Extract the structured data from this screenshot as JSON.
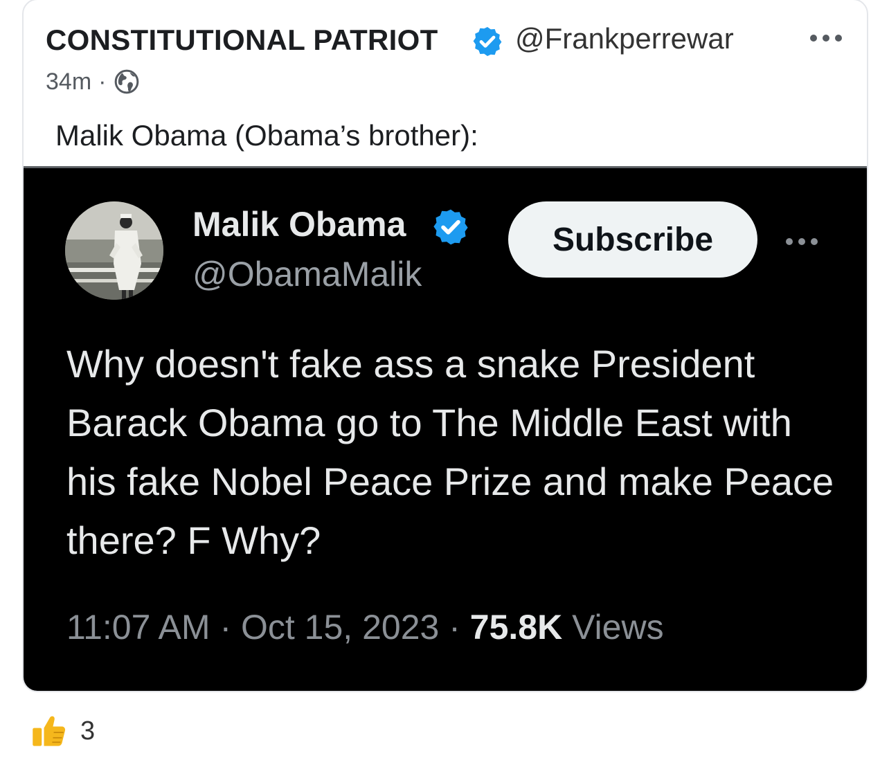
{
  "post": {
    "author_name": "CONSTITUTIONAL PATRIOT",
    "author_handle": "@Frankperrewar",
    "time_ago": "34m",
    "separator": "·",
    "caption": "Malik Obama (Obama’s brother):",
    "visibility_icon": "globe-icon",
    "more_icon": "more-options-icon"
  },
  "embedded_tweet": {
    "name": "Malik Obama",
    "handle": "@ObamaMalik",
    "subscribe_label": "Subscribe",
    "text": "Why doesn't fake ass a snake President Barack Obama go to The Middle East with his fake Nobel Peace Prize and make Peace there? F Why?",
    "time": "11:07 AM",
    "date": "Oct 15, 2023",
    "separator": "·",
    "views_count": "75.8K",
    "views_label": "Views"
  },
  "reactions": {
    "icon": "thumbs-up-icon",
    "count": "3"
  },
  "colors": {
    "verified_blue": "#1d9bf0",
    "tweet_background": "#000000",
    "subscribe_background": "#eff3f4"
  }
}
